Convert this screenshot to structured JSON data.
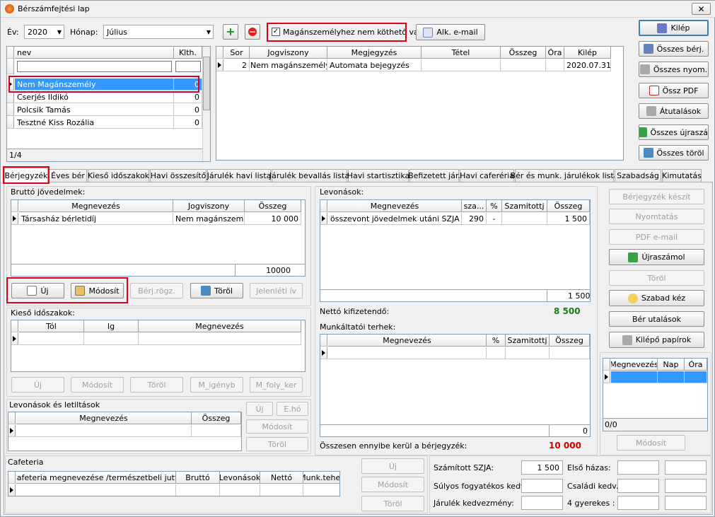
{
  "title": "Bérszámfejtési lap",
  "top": {
    "year_label": "Év:",
    "year": "2020",
    "month_label": "Hónap:",
    "month": "Július",
    "private_label": "Magánszemélyhez nem köthető van",
    "email_btn": "Alk. e-mail"
  },
  "right_buttons": [
    "Kilép",
    "Összes bérj.",
    "Összes nyom.",
    "Össz PDF",
    "Átutalások",
    "Összes újraszá.",
    "Összes töröl"
  ],
  "people": {
    "headers": [
      "nev",
      "Klth."
    ],
    "rows": [
      [
        "Nem Magánszemély",
        "0"
      ],
      [
        "Cserjés Ildikó",
        "0"
      ],
      [
        "Polcsik Tamás",
        "0"
      ],
      [
        "Tesztné Kiss Rozália",
        "0"
      ]
    ],
    "count": "1/4"
  },
  "entries": {
    "headers": [
      "Sor",
      "Jogviszony",
      "Megjegyzés",
      "Tétel",
      "Összeg",
      "Óra",
      "Kilép"
    ],
    "rows": [
      [
        "2",
        "Nem magánszemélyhez",
        "Automata bejegyzés",
        "",
        "",
        "",
        "2020.07.31."
      ]
    ]
  },
  "tabs": [
    "Bérjegyzék",
    "Éves bér",
    "Kieső időszakok",
    "Havi összesítő",
    "Járulék havi lista",
    "Járulék bevallás lista",
    "Havi startisztika",
    "Befizetett jár.",
    "Havi caferéria",
    "Bér és munk. járulékok lista",
    "Szabadság",
    "Kimutatás"
  ],
  "gross": {
    "label": "Bruttó jövedelmek:",
    "headers": [
      "Megnevezés",
      "Jogviszony",
      "Összeg"
    ],
    "rows": [
      [
        "Társasház bérletidíj",
        "Nem magánszemél...",
        "10 000"
      ]
    ],
    "total": "10000",
    "buttons": [
      "Új",
      "Módosít",
      "Bérj.rögz.",
      "Töröl",
      "Jelenléti ív"
    ]
  },
  "absence": {
    "label": "Kieső időszakok:",
    "headers": [
      "Tól",
      "Ig",
      "Megnevezés"
    ],
    "buttons": [
      "Új",
      "Módosít",
      "Töröl",
      "M_igényb",
      "M_foly_ker"
    ]
  },
  "levy": {
    "label": "Levonások és letiltások",
    "headers": [
      "Megnevezés",
      "Összeg"
    ],
    "buttons": [
      "Új",
      "E.hó",
      "Módosít",
      "Töröl"
    ]
  },
  "cafeteria": {
    "label": "Cafeteria",
    "headers": [
      "Cafeteria megnevezése /természetbeli jutt/",
      "Bruttó",
      "Levonások",
      "Nettó",
      "Munk.teher"
    ],
    "buttons": [
      "Új",
      "Módosít",
      "Töröl"
    ]
  },
  "deductions": {
    "label": "Levonások:",
    "headers": [
      "Megnevezés",
      "sza...",
      "%",
      "Szamitottj",
      "Összeg"
    ],
    "rows": [
      [
        "összevont jövedelmek utáni SZJA",
        "290",
        "-",
        "",
        "1 500"
      ]
    ],
    "total": "1 500",
    "net_label": "Nettó kifizetendő:",
    "net": "8 500"
  },
  "employer": {
    "label": "Munkáltatói terhek:",
    "headers": [
      "Megnevezés",
      "%",
      "Szamitottj",
      "Összeg"
    ],
    "total": "0",
    "sum_label": "Összesen ennyibe kerül a bérjegyzék:",
    "sum": "10 000"
  },
  "side_buttons": [
    "Bérjegyzék készít",
    "Nyomtatás",
    "PDF e-mail",
    "Újraszámol",
    "Töröl",
    "Szabad kéz",
    "Bér utalások",
    "Kilépő papírok"
  ],
  "leave": {
    "headers": [
      "Megnevezés",
      "Nap",
      "Óra"
    ],
    "count": "0/0",
    "button": "Módosít"
  },
  "tax": {
    "szja_label": "Számított SZJA:",
    "szja": "1 500",
    "elso_label": "Első házas:",
    "sulyos_label": "Súlyos fogyatékos kedv.:",
    "csaladi_label": "Családi kedv.:",
    "jarulek_label": "Járulék kedvezmény:",
    "gyerek_label": "4 gyerekes :"
  },
  "colors": {
    "select": "#3399ff",
    "highlight": "#e0001a",
    "net": "#1a7a1a",
    "sum": "#d40000"
  }
}
